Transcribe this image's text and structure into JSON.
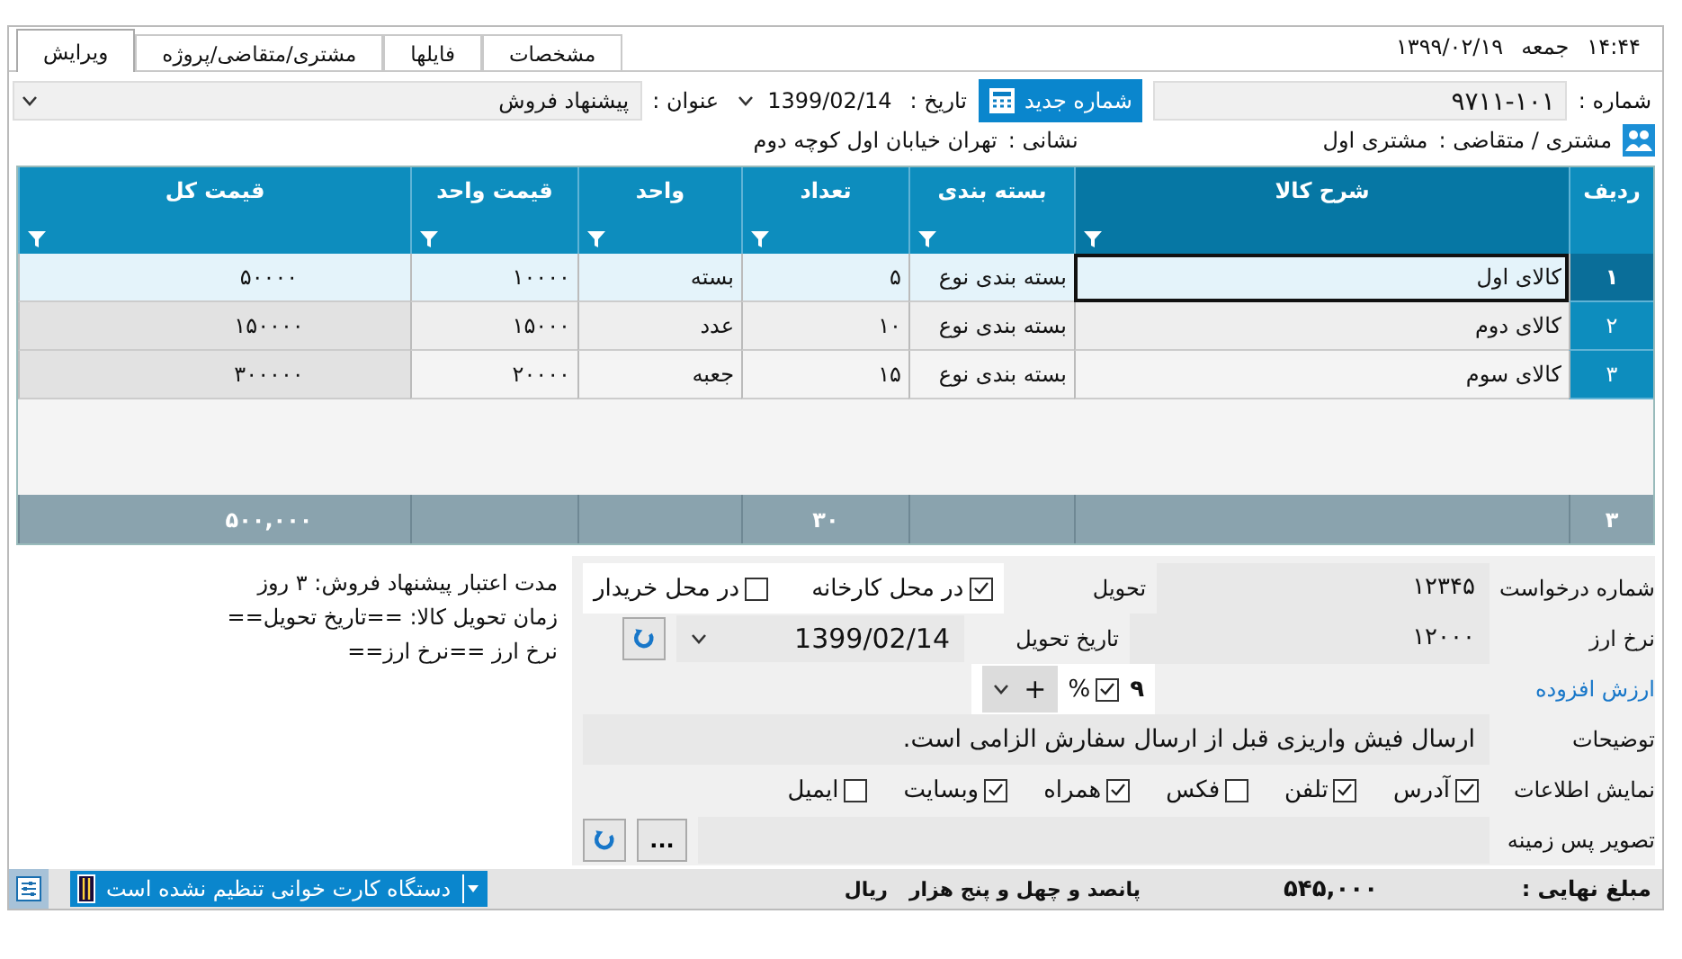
{
  "header": {
    "time": "۱۴:۴۴",
    "weekday": "جمعه",
    "date": "۱۳۹۹/۰۲/۱۹"
  },
  "tabs": [
    {
      "label": "مشخصات",
      "selected": false
    },
    {
      "label": "فایلها",
      "selected": false
    },
    {
      "label": "مشتری/متقاضی/پروژه",
      "selected": false
    },
    {
      "label": "ویرایش",
      "selected": true
    }
  ],
  "form": {
    "number_label": "شماره :",
    "number": "۹۷۱۱-۱۰۱",
    "new_number_button": "شماره جدید",
    "date_label": "تاریخ :",
    "date": "1399/02/14",
    "title_label": "عنوان :",
    "title": "پیشنهاد فروش",
    "customer_label": "مشتری / متقاضی :",
    "customer": "مشتری اول",
    "address_label": "نشانی :",
    "address": "تهران خیابان اول کوچه دوم"
  },
  "table": {
    "columns": [
      "ردیف",
      "شرح کالا",
      "بسته بندی",
      "تعداد",
      "واحد",
      "قیمت واحد",
      "قیمت کل"
    ],
    "rows": [
      {
        "selected": true,
        "cells": [
          "۱",
          "کالای اول",
          "بسته بندی نوع",
          "۵",
          "بسته",
          "۱۰۰۰۰",
          "۵۰۰۰۰"
        ]
      },
      {
        "selected": false,
        "cells": [
          "۲",
          "کالای دوم",
          "بسته بندی نوع",
          "۱۰",
          "عدد",
          "۱۵۰۰۰",
          "۱۵۰۰۰۰"
        ]
      },
      {
        "selected": false,
        "cells": [
          "۳",
          "کالای سوم",
          "بسته بندی نوع",
          "۱۵",
          "جعبه",
          "۲۰۰۰۰",
          "۳۰۰۰۰۰"
        ]
      }
    ],
    "footer": {
      "row_count": "۳",
      "quantity_total": "۳۰",
      "total": "۵۰۰,۰۰۰"
    }
  },
  "details": {
    "request_label": "شماره درخواست",
    "request_number": "۱۲۳۴۵",
    "delivery_label": "تحویل",
    "delivery_options": [
      {
        "label": "در محل کارخانه",
        "checked": true
      },
      {
        "label": "در محل خریدار",
        "checked": false
      }
    ],
    "rate_label": "نرخ ارز",
    "rate": "۱۲۰۰۰",
    "delivery_date_label": "تاریخ تحویل",
    "delivery_date": "1399/02/14",
    "vat_label": "ارزش افزوده",
    "vat_value": "۹",
    "vat_percent": {
      "label": "%",
      "checked": true
    },
    "vat_plus": "+",
    "notes_label": "توضیحات",
    "notes": "ارسال فیش واریزی قبل از ارسال سفارش الزامی است.",
    "display_label": "نمایش اطلاعات",
    "display_options": [
      {
        "label": "آدرس",
        "checked": true
      },
      {
        "label": "تلفن",
        "checked": true
      },
      {
        "label": "فکس",
        "checked": false
      },
      {
        "label": "همراه",
        "checked": true
      },
      {
        "label": "وبسایت",
        "checked": true
      },
      {
        "label": "ایمیل",
        "checked": false
      }
    ],
    "background_label": "تصویر پس زمینه",
    "browse_button": "...",
    "remarks": [
      "مدت اعتبار پیشنهاد فروش: ۳ روز",
      "زمان تحویل کالا: ==تاریخ تحویل==",
      "نرخ ارز ==نرخ ارز=="
    ]
  },
  "status_bar": {
    "final_label": "مبلغ نهایی :",
    "final_amount": "۵۴۵,۰۰۰",
    "amount_words": "پانصد و چهل و پنج هزار",
    "currency": "ریال",
    "card_reader": "دستگاه کارت خوانی تنظیم نشده است"
  }
}
